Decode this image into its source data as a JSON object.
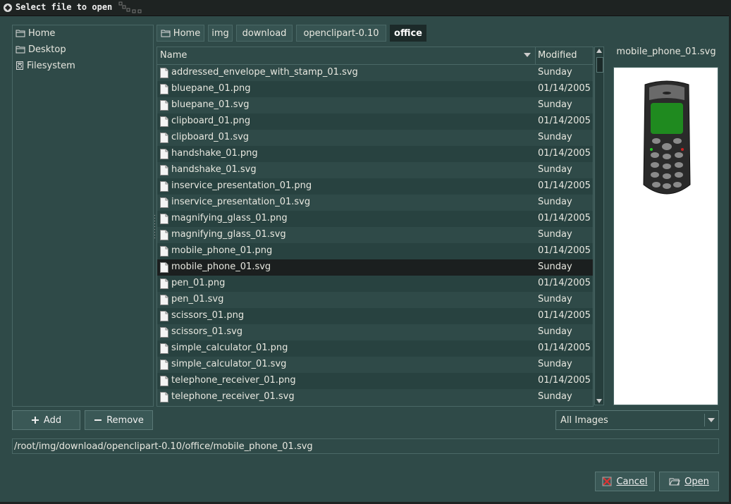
{
  "window": {
    "title": "Select file to open"
  },
  "places": [
    {
      "label": "Home",
      "icon": "folder-icon"
    },
    {
      "label": "Desktop",
      "icon": "folder-icon"
    },
    {
      "label": "Filesystem",
      "icon": "drive-icon"
    }
  ],
  "pathbar": [
    "Home",
    "img",
    "download",
    "openclipart-0.10",
    "office"
  ],
  "columns": {
    "name": "Name",
    "modified": "Modified"
  },
  "files": [
    {
      "name": "addressed_envelope_with_stamp_01.svg",
      "modified": "Sunday"
    },
    {
      "name": "bluepane_01.png",
      "modified": "01/14/2005"
    },
    {
      "name": "bluepane_01.svg",
      "modified": "Sunday"
    },
    {
      "name": "clipboard_01.png",
      "modified": "01/14/2005"
    },
    {
      "name": "clipboard_01.svg",
      "modified": "Sunday"
    },
    {
      "name": "handshake_01.png",
      "modified": "01/14/2005"
    },
    {
      "name": "handshake_01.svg",
      "modified": "Sunday"
    },
    {
      "name": "inservice_presentation_01.png",
      "modified": "01/14/2005"
    },
    {
      "name": "inservice_presentation_01.svg",
      "modified": "Sunday"
    },
    {
      "name": "magnifying_glass_01.png",
      "modified": "01/14/2005"
    },
    {
      "name": "magnifying_glass_01.svg",
      "modified": "Sunday"
    },
    {
      "name": "mobile_phone_01.png",
      "modified": "01/14/2005"
    },
    {
      "name": "mobile_phone_01.svg",
      "modified": "Sunday",
      "selected": true
    },
    {
      "name": "pen_01.png",
      "modified": "01/14/2005"
    },
    {
      "name": "pen_01.svg",
      "modified": "Sunday"
    },
    {
      "name": "scissors_01.png",
      "modified": "01/14/2005"
    },
    {
      "name": "scissors_01.svg",
      "modified": "Sunday"
    },
    {
      "name": "simple_calculator_01.png",
      "modified": "01/14/2005"
    },
    {
      "name": "simple_calculator_01.svg",
      "modified": "Sunday"
    },
    {
      "name": "telephone_receiver_01.png",
      "modified": "01/14/2005"
    },
    {
      "name": "telephone_receiver_01.svg",
      "modified": "Sunday"
    }
  ],
  "preview": {
    "filename": "mobile_phone_01.svg"
  },
  "buttons": {
    "add": "Add",
    "remove": "Remove",
    "cancel": "Cancel",
    "open": "Open"
  },
  "filter": {
    "selected": "All Images"
  },
  "location": {
    "value": "/root/img/download/openclipart-0.10/office/mobile_phone_01.svg"
  },
  "colors": {
    "background": "#2f4a48",
    "selection": "#1b1f1f",
    "titlebar": "#1e2322",
    "phone_screen": "#1f8a1f"
  }
}
